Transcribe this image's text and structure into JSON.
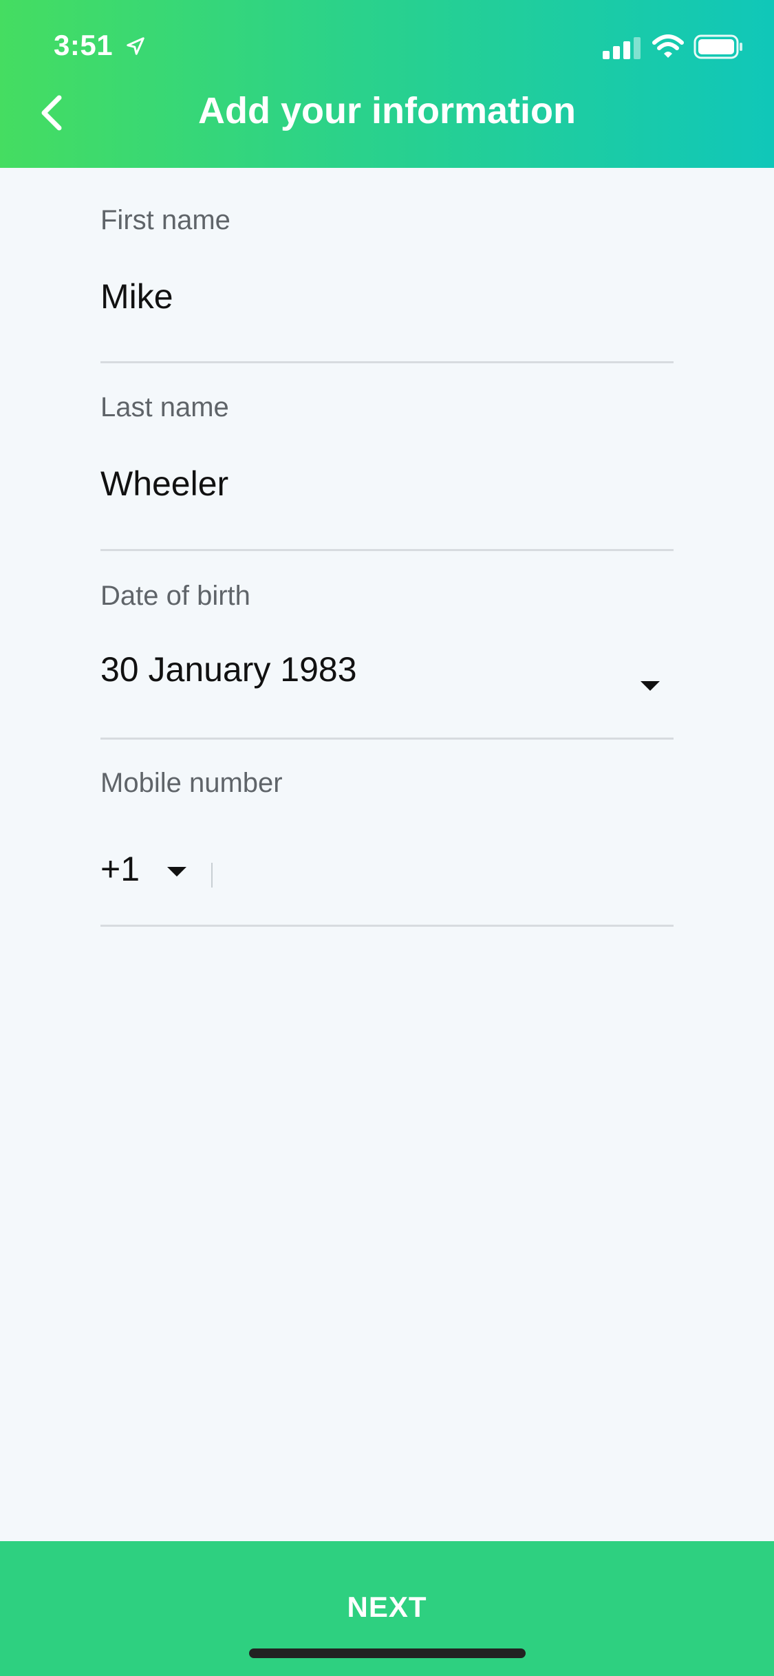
{
  "status_bar": {
    "time": "3:51",
    "icons": [
      "location-arrow-icon",
      "signal-icon",
      "wifi-icon",
      "battery-icon"
    ]
  },
  "header": {
    "title": "Add your information",
    "back_icon": "chevron-left-icon"
  },
  "form": {
    "first_name": {
      "label": "First name",
      "value": "Mike"
    },
    "last_name": {
      "label": "Last name",
      "value": "Wheeler"
    },
    "date_of_birth": {
      "label": "Date of birth",
      "value": "30 January 1983"
    },
    "mobile_number": {
      "label": "Mobile number",
      "country_code": "+1",
      "value": ""
    }
  },
  "footer": {
    "next_label": "NEXT"
  },
  "colors": {
    "header_gradient_start": "#45dd61",
    "header_gradient_end": "#10c7b9",
    "button_bg": "#2ed080",
    "page_bg": "#f4f8fb"
  }
}
